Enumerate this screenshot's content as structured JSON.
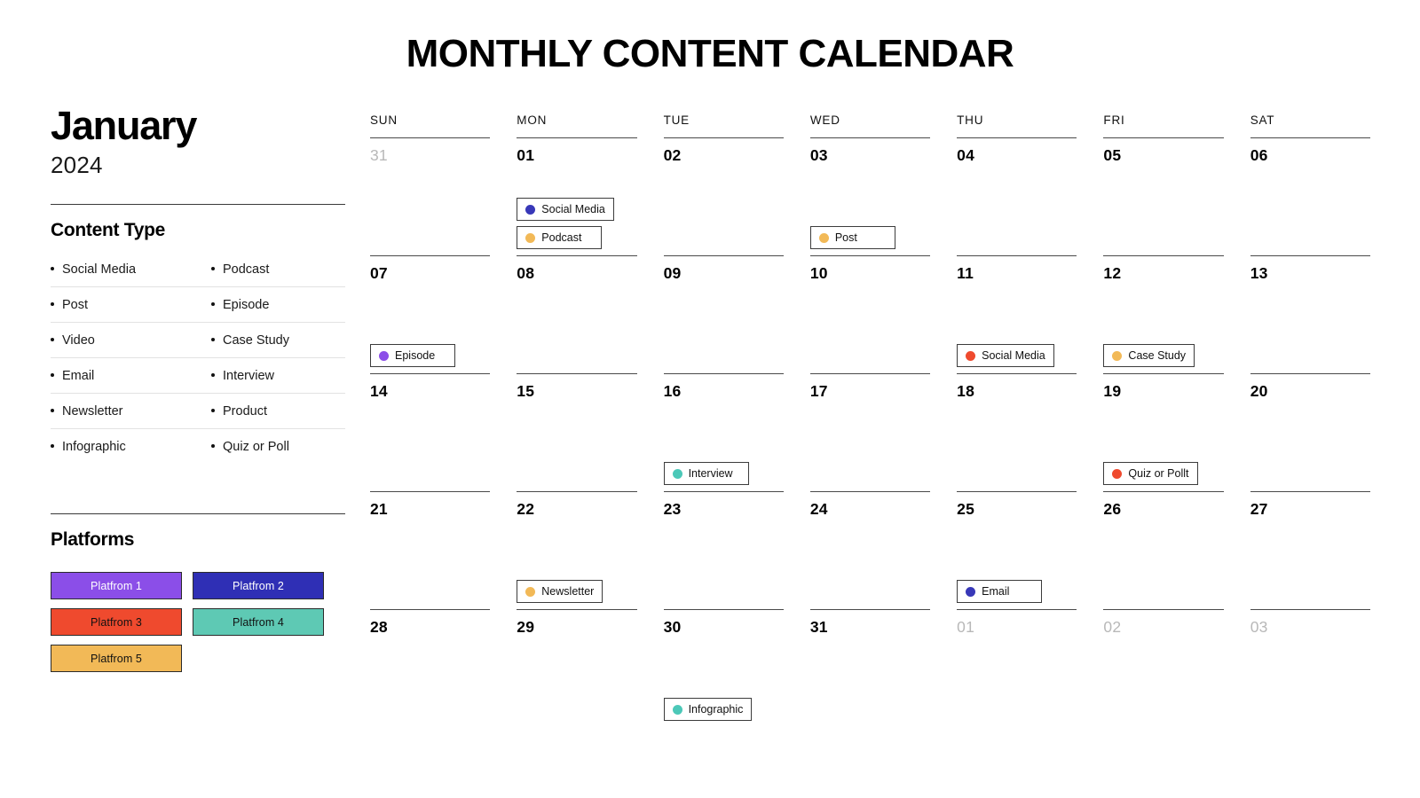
{
  "title": "MONTHLY CONTENT CALENDAR",
  "sidebar": {
    "month": "January",
    "year": "2024",
    "content_type_heading": "Content Type",
    "content_types": [
      [
        "Social Media",
        "Podcast"
      ],
      [
        "Post",
        "Episode"
      ],
      [
        "Video",
        "Case Study"
      ],
      [
        "Email",
        "Interview"
      ],
      [
        "Newsletter",
        "Product"
      ],
      [
        "Infographic",
        "Quiz or Poll"
      ]
    ],
    "platforms_heading": "Platforms",
    "platforms": [
      {
        "label": "Platfrom 1",
        "color": "#8b4ee8",
        "text_color": "#ffffff"
      },
      {
        "label": "Platfrom 2",
        "color": "#2f2fb5",
        "text_color": "#ffffff"
      },
      {
        "label": "Platfrom 3",
        "color": "#ef4a2e",
        "text_color": "#111111"
      },
      {
        "label": "Platfrom 4",
        "color": "#5ec9b4",
        "text_color": "#111111"
      },
      {
        "label": "Platfrom 5",
        "color": "#f2b957",
        "text_color": "#111111"
      }
    ]
  },
  "calendar": {
    "day_headers": [
      "SUN",
      "MON",
      "TUE",
      "WED",
      "THU",
      "FRI",
      "SAT"
    ],
    "dot_colors": {
      "blue": "#3838b8",
      "orange": "#f2b957",
      "purple": "#8b4ee8",
      "red": "#ef4a2e",
      "teal": "#4cc8b8"
    },
    "weeks": [
      [
        {
          "num": "31",
          "muted": true,
          "events": []
        },
        {
          "num": "01",
          "muted": false,
          "events": [
            {
              "label": "Social Media",
              "color": "#3838b8"
            },
            {
              "label": "Podcast",
              "color": "#f2b957"
            }
          ]
        },
        {
          "num": "02",
          "muted": false,
          "events": []
        },
        {
          "num": "03",
          "muted": false,
          "events": [
            {
              "label": "Post",
              "color": "#f2b957"
            }
          ]
        },
        {
          "num": "04",
          "muted": false,
          "events": []
        },
        {
          "num": "05",
          "muted": false,
          "events": []
        },
        {
          "num": "06",
          "muted": false,
          "events": []
        }
      ],
      [
        {
          "num": "07",
          "muted": false,
          "events": [
            {
              "label": "Episode",
              "color": "#8b4ee8"
            }
          ]
        },
        {
          "num": "08",
          "muted": false,
          "events": []
        },
        {
          "num": "09",
          "muted": false,
          "events": []
        },
        {
          "num": "10",
          "muted": false,
          "events": []
        },
        {
          "num": "11",
          "muted": false,
          "events": [
            {
              "label": "Social Media",
              "color": "#ef4a2e"
            }
          ]
        },
        {
          "num": "12",
          "muted": false,
          "events": [
            {
              "label": "Case Study",
              "color": "#f2b957"
            }
          ]
        },
        {
          "num": "13",
          "muted": false,
          "events": []
        }
      ],
      [
        {
          "num": "14",
          "muted": false,
          "events": []
        },
        {
          "num": "15",
          "muted": false,
          "events": []
        },
        {
          "num": "16",
          "muted": false,
          "events": [
            {
              "label": "Interview",
              "color": "#4cc8b8"
            }
          ]
        },
        {
          "num": "17",
          "muted": false,
          "events": []
        },
        {
          "num": "18",
          "muted": false,
          "events": []
        },
        {
          "num": "19",
          "muted": false,
          "events": [
            {
              "label": "Quiz or Pollt",
              "color": "#ef4a2e"
            }
          ]
        },
        {
          "num": "20",
          "muted": false,
          "events": []
        }
      ],
      [
        {
          "num": "21",
          "muted": false,
          "events": []
        },
        {
          "num": "22",
          "muted": false,
          "events": [
            {
              "label": "Newsletter",
              "color": "#f2b957"
            }
          ]
        },
        {
          "num": "23",
          "muted": false,
          "events": []
        },
        {
          "num": "24",
          "muted": false,
          "events": []
        },
        {
          "num": "25",
          "muted": false,
          "events": [
            {
              "label": "Email",
              "color": "#3838b8"
            }
          ]
        },
        {
          "num": "26",
          "muted": false,
          "events": []
        },
        {
          "num": "27",
          "muted": false,
          "events": []
        }
      ],
      [
        {
          "num": "28",
          "muted": false,
          "events": []
        },
        {
          "num": "29",
          "muted": false,
          "events": []
        },
        {
          "num": "30",
          "muted": false,
          "events": [
            {
              "label": "Infographic",
              "color": "#4cc8b8"
            }
          ]
        },
        {
          "num": "31",
          "muted": false,
          "events": []
        },
        {
          "num": "01",
          "muted": true,
          "events": []
        },
        {
          "num": "02",
          "muted": true,
          "events": []
        },
        {
          "num": "03",
          "muted": true,
          "events": []
        }
      ]
    ]
  }
}
